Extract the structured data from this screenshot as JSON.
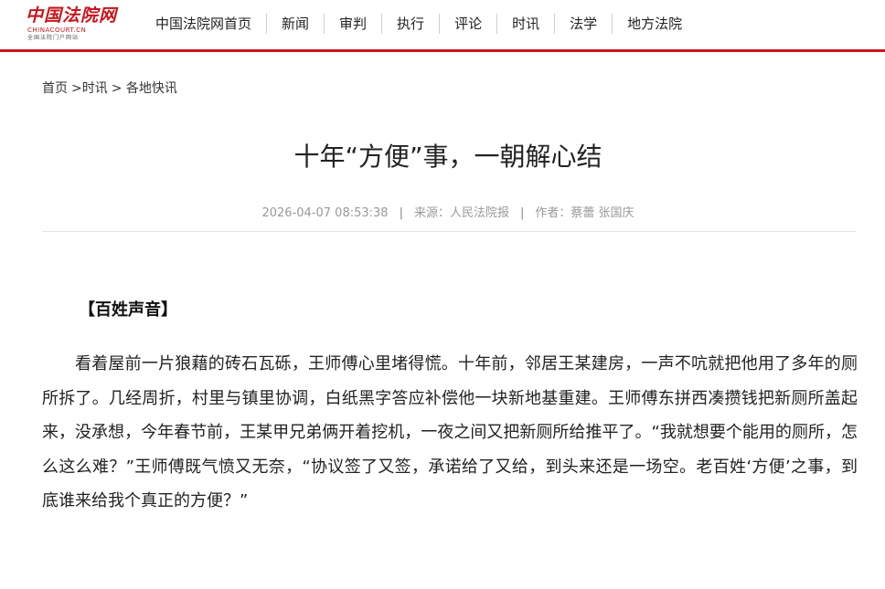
{
  "logo": {
    "main": "中国法院网",
    "domain": "CHINACOURT.CN",
    "sub": "全国法院门户网站"
  },
  "nav": {
    "items": [
      {
        "label": "中国法院网首页"
      },
      {
        "label": "新闻"
      },
      {
        "label": "审判"
      },
      {
        "label": "执行"
      },
      {
        "label": "评论"
      },
      {
        "label": "时讯"
      },
      {
        "label": "法学"
      },
      {
        "label": "地方法院"
      }
    ]
  },
  "breadcrumb": {
    "home": "首页",
    "level1": ">时讯",
    "level2": "> 各地快讯"
  },
  "article": {
    "title": "十年“方便”事，一朝解心结",
    "datetime": "2026-04-07 08:53:38",
    "source": "来源：人民法院报",
    "author": "作者：蔡蕾  张国庆",
    "meta_separator": "|",
    "section_head": "【百姓声音】",
    "paragraph": "看着屋前一片狼藉的砖石瓦砾，王师傅心里堵得慌。十年前，邻居王某建房，一声不吭就把他用了多年的厕所拆了。几经周折，村里与镇里协调，白纸黑字答应补偿他一块新地基重建。王师傅东拼西凑攒钱把新厕所盖起来，没承想，今年春节前，王某甲兄弟俩开着挖机，一夜之间又把新厕所给推平了。“我就想要个能用的厕所，怎么这么难？”王师傅既气愤又无奈，“协议签了又签，承诺给了又给，到头来还是一场空。老百姓‘方便’之事，到底谁来给我个真正的方便？”"
  },
  "colors": {
    "brand_red": "#c8151d",
    "meta_gray": "#999999"
  }
}
